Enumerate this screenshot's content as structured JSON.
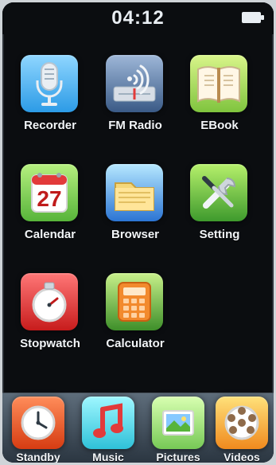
{
  "status": {
    "time": "04:12"
  },
  "apps": [
    {
      "label": "Recorder",
      "icon": "microphone-icon"
    },
    {
      "label": "FM Radio",
      "icon": "radio-icon"
    },
    {
      "label": "EBook",
      "icon": "book-icon"
    },
    {
      "label": "Calendar",
      "icon": "calendar-icon",
      "day": "27"
    },
    {
      "label": "Browser",
      "icon": "folder-icon"
    },
    {
      "label": "Setting",
      "icon": "tools-icon"
    },
    {
      "label": "Stopwatch",
      "icon": "stopwatch-icon"
    },
    {
      "label": "Calculator",
      "icon": "calculator-icon"
    }
  ],
  "dock": [
    {
      "label": "Standby",
      "icon": "clock-icon"
    },
    {
      "label": "Music",
      "icon": "music-note-icon"
    },
    {
      "label": "Pictures",
      "icon": "pictures-icon"
    },
    {
      "label": "Videos",
      "icon": "film-reel-icon"
    }
  ]
}
